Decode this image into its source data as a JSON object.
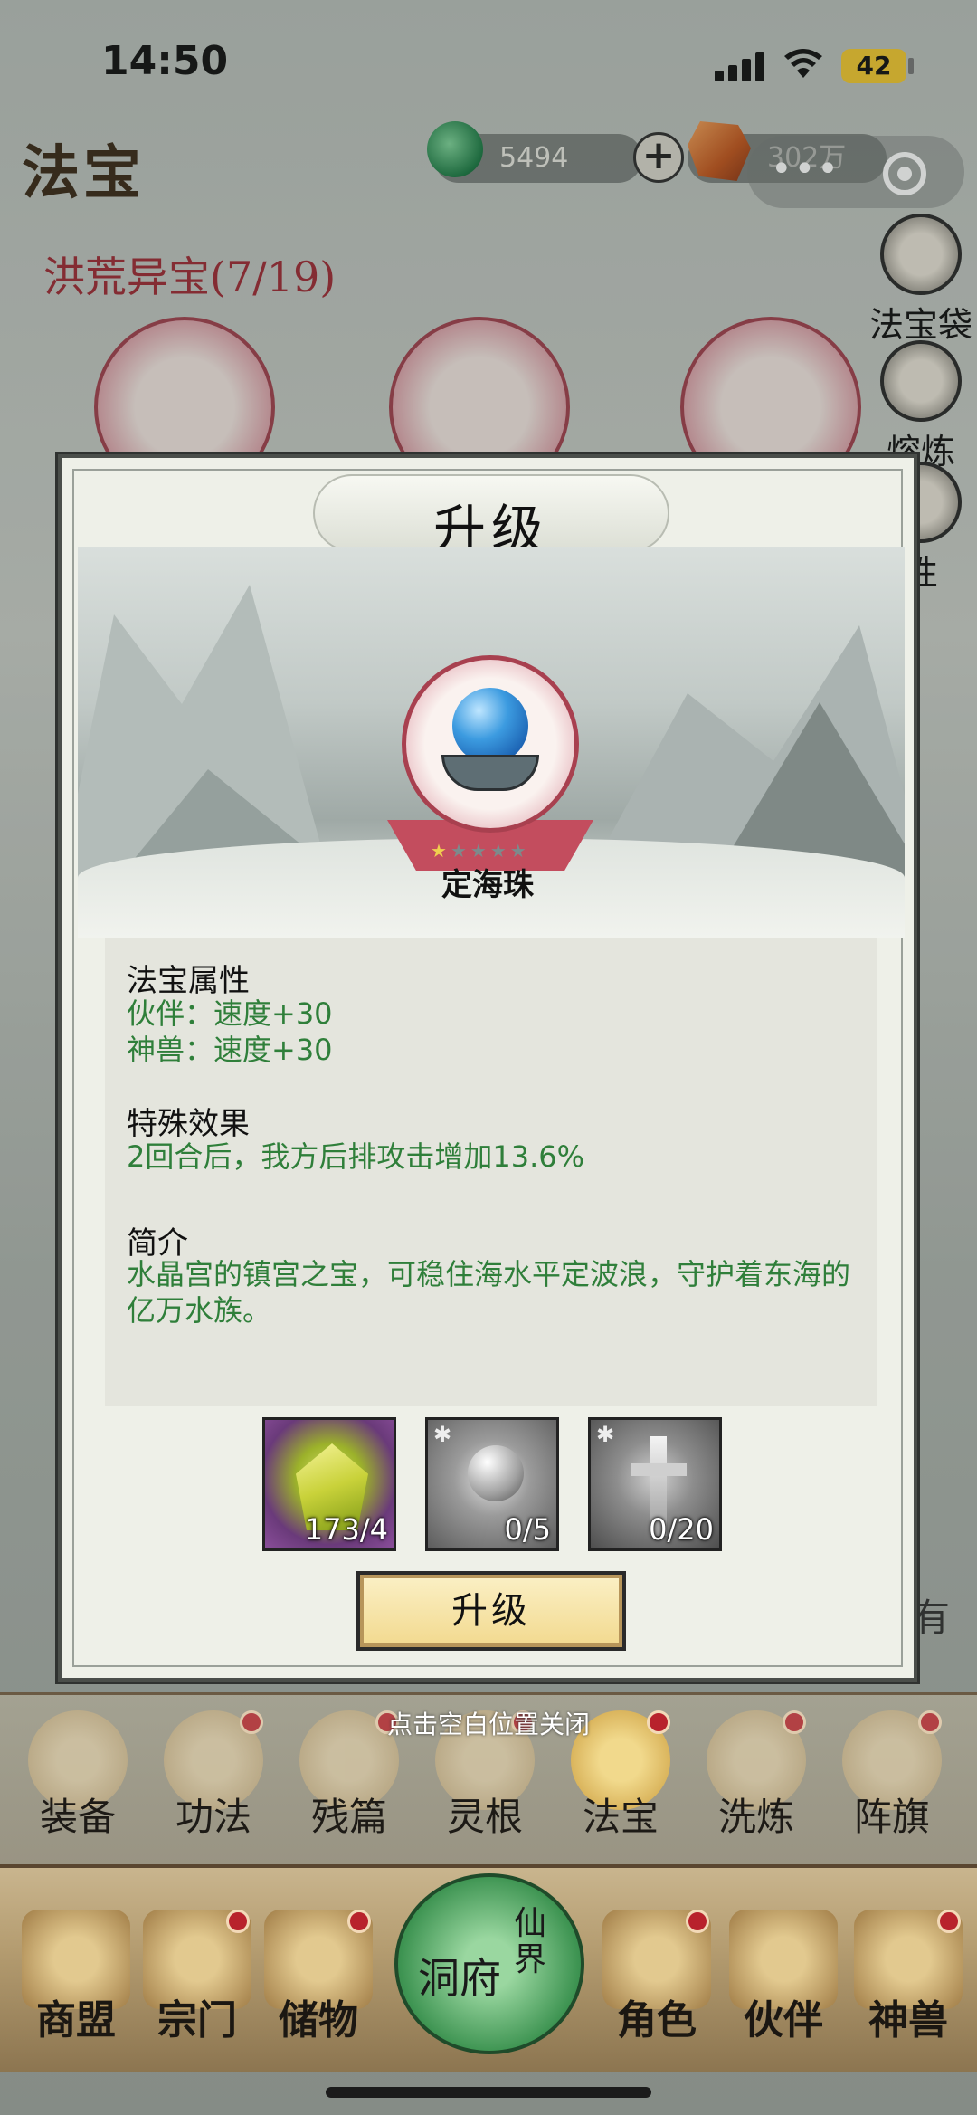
{
  "status_bar": {
    "time": "14:50",
    "battery": "42"
  },
  "header": {
    "title": "法宝",
    "jade_amount": "5494",
    "gold_amount": "302万"
  },
  "collection": {
    "title": "洪荒异宝(7/19)"
  },
  "side_menu": [
    {
      "label": "法宝袋",
      "icon": "treasure-bag-icon"
    },
    {
      "label": "熔炼",
      "icon": "furnace-icon"
    },
    {
      "label": "性",
      "icon": "attribute-icon"
    }
  ],
  "background_edge_text": "有",
  "modal": {
    "title": "升级",
    "treasure_name": "定海珠",
    "stars_lit": 1,
    "stars_total": 5,
    "attr_title": "法宝属性",
    "attr_lines": [
      "伙伴：速度+30",
      "神兽：速度+30"
    ],
    "effect_title": "特殊效果",
    "effect_text": "2回合后，我方后排攻击增加13.6%",
    "intro_title": "简介",
    "intro_text": "水晶宫的镇宫之宝，可稳住海水平定波浪，守护着东海的亿万水族。",
    "materials": [
      {
        "count": "173/4",
        "icon": "crystal-icon"
      },
      {
        "count": "0/5",
        "icon": "orb-icon"
      },
      {
        "count": "0/20",
        "icon": "sword-icon"
      }
    ],
    "upgrade_button": "升级"
  },
  "close_hint": "点击空白位置关闭",
  "tabs": [
    {
      "label": "装备"
    },
    {
      "label": "功法"
    },
    {
      "label": "残篇"
    },
    {
      "label": "灵根"
    },
    {
      "label": "法宝"
    },
    {
      "label": "洗炼"
    },
    {
      "label": "阵旗"
    }
  ],
  "nav": {
    "items": [
      {
        "label": "商盟"
      },
      {
        "label": "宗门"
      },
      {
        "label": "储物"
      },
      {
        "label": "角色"
      },
      {
        "label": "伙伴"
      },
      {
        "label": "神兽"
      }
    ],
    "center_left": "洞府",
    "center_right": "仙界"
  },
  "colors": {
    "accent_red": "#9e2b35",
    "effect_green": "#2f7f3a",
    "button_gold": "#f2d98e"
  }
}
